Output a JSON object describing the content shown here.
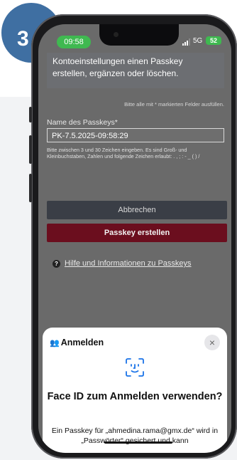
{
  "step": {
    "number": "3"
  },
  "statusbar": {
    "time": "09:58",
    "network": "5G",
    "battery": "52"
  },
  "page": {
    "intro_text": "Kontoeinstellungen einen Passkey erstellen, ergänzen oder löschen.",
    "required_note": "Bitte alle mit * markierten Felder ausfüllen.",
    "field_label": "Name des Passkeys*",
    "field_value": "PK-7.5.2025-09:58:29",
    "hint_text": "Bitte zwischen 3 und 30 Zeichen eingeben. Es sind Groß- und Kleinbuchstaben, Zahlen und folgende Zeichen erlaubt: . , ; : - _ ( ) /",
    "cancel_label": "Abbrechen",
    "create_label": "Passkey erstellen",
    "help_label": "Hilfe und Informationen zu Passkeys"
  },
  "sheet": {
    "title": "Anmelden",
    "close_symbol": "×",
    "heading": "Face ID zum Anmelden verwenden?",
    "body": "Ein Passkey für „ahmedina.rama@gmx.de“ wird in „Passwörter“ gesichert und kann"
  },
  "colors": {
    "accent_green": "#3fb950",
    "create_button": "#6b0e1e",
    "badge_blue": "#3f6fa2",
    "faceid_blue": "#1a73e8"
  },
  "icons": {
    "help": "question-circle-icon",
    "sheet_title": "person-key-icon",
    "faceid": "face-id-icon",
    "close": "close-icon"
  }
}
